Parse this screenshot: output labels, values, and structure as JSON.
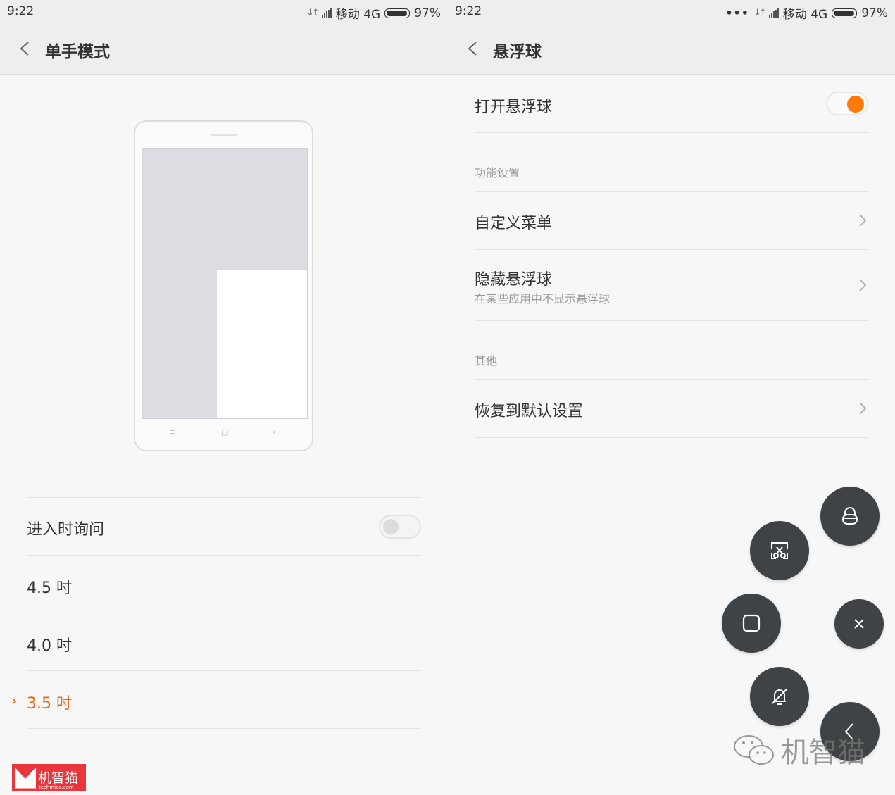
{
  "left": {
    "status": {
      "time": "9:22",
      "carrier": "移动 4G",
      "battery": "97%"
    },
    "title": "单手模式",
    "ask_on_enter": {
      "label": "进入时询问",
      "enabled": false
    },
    "sizes": [
      {
        "label": "4.5 吋",
        "selected": false
      },
      {
        "label": "4.0 吋",
        "selected": false
      },
      {
        "label": "3.5 吋",
        "selected": true
      }
    ]
  },
  "right": {
    "status": {
      "time": "9:22",
      "carrier": "移动 4G",
      "battery": "97%"
    },
    "title": "悬浮球",
    "toggle": {
      "label": "打开悬浮球",
      "enabled": true
    },
    "section_function": "功能设置",
    "custom_menu": "自定义菜单",
    "hide_ball": {
      "label": "隐藏悬浮球",
      "subtitle": "在某些应用中不显示悬浮球"
    },
    "section_other": "其他",
    "reset": "恢复到默认设置",
    "float_buttons": [
      "lock-icon",
      "screenshot-icon",
      "recent-apps-icon",
      "close-icon",
      "mute-bell-icon",
      "back-icon"
    ]
  },
  "watermark": "机智猫",
  "logo": {
    "text": "机智猫",
    "url": "techmiao.com"
  },
  "colors": {
    "accent": "#ff7a0a",
    "selected_text": "#e36c1c",
    "fab": "#3f4346"
  }
}
